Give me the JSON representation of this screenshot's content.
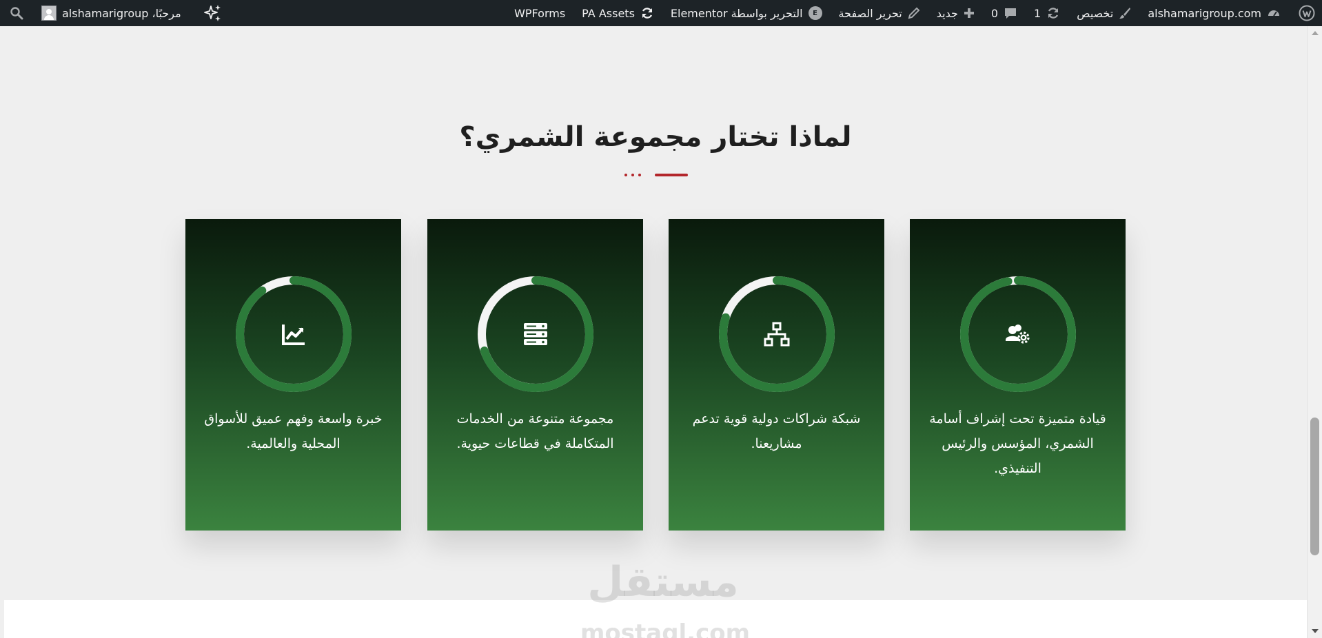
{
  "adminbar": {
    "site_name": "alshamarigroup.com",
    "customize_label": "تخصيص",
    "updates_count": "1",
    "comments_count": "0",
    "new_label": "جديد",
    "edit_page_label": "تحرير الصفحة",
    "elementor_label": "التحرير بواسطة Elementor",
    "pa_assets_label": "PA Assets",
    "wpforms_label": "WPForms",
    "greeting": "مرحبًا، alshamarigroup"
  },
  "section": {
    "title": "لماذا تختار مجموعة الشمري؟",
    "accent_color": "#b3262b"
  },
  "cards": [
    {
      "icon": "users-gear-icon",
      "progress": 0.97,
      "text": "قيادة متميزة تحت إشراف أسامة الشمري، المؤسس والرئيس التنفيذي."
    },
    {
      "icon": "network-icon",
      "progress": 0.8,
      "text": "شبكة شراكات دولية قوية تدعم مشاريعنا."
    },
    {
      "icon": "server-icon",
      "progress": 0.7,
      "text": "مجموعة متنوعة من الخدمات المتكاملة في قطاعات حيوية."
    },
    {
      "icon": "chart-line-icon",
      "progress": 0.9,
      "text": "خبرة واسعة وفهم عميق للأسواق المحلية والعالمية."
    }
  ],
  "colors": {
    "ring_track": "#f4f4f4",
    "ring_progress": "#2c7b3a",
    "card_gradient_top": "#0a1a0c",
    "card_gradient_bottom": "#3b833f"
  },
  "watermark": {
    "logo_text": "مستقل",
    "url_text": "mostaql.com"
  }
}
